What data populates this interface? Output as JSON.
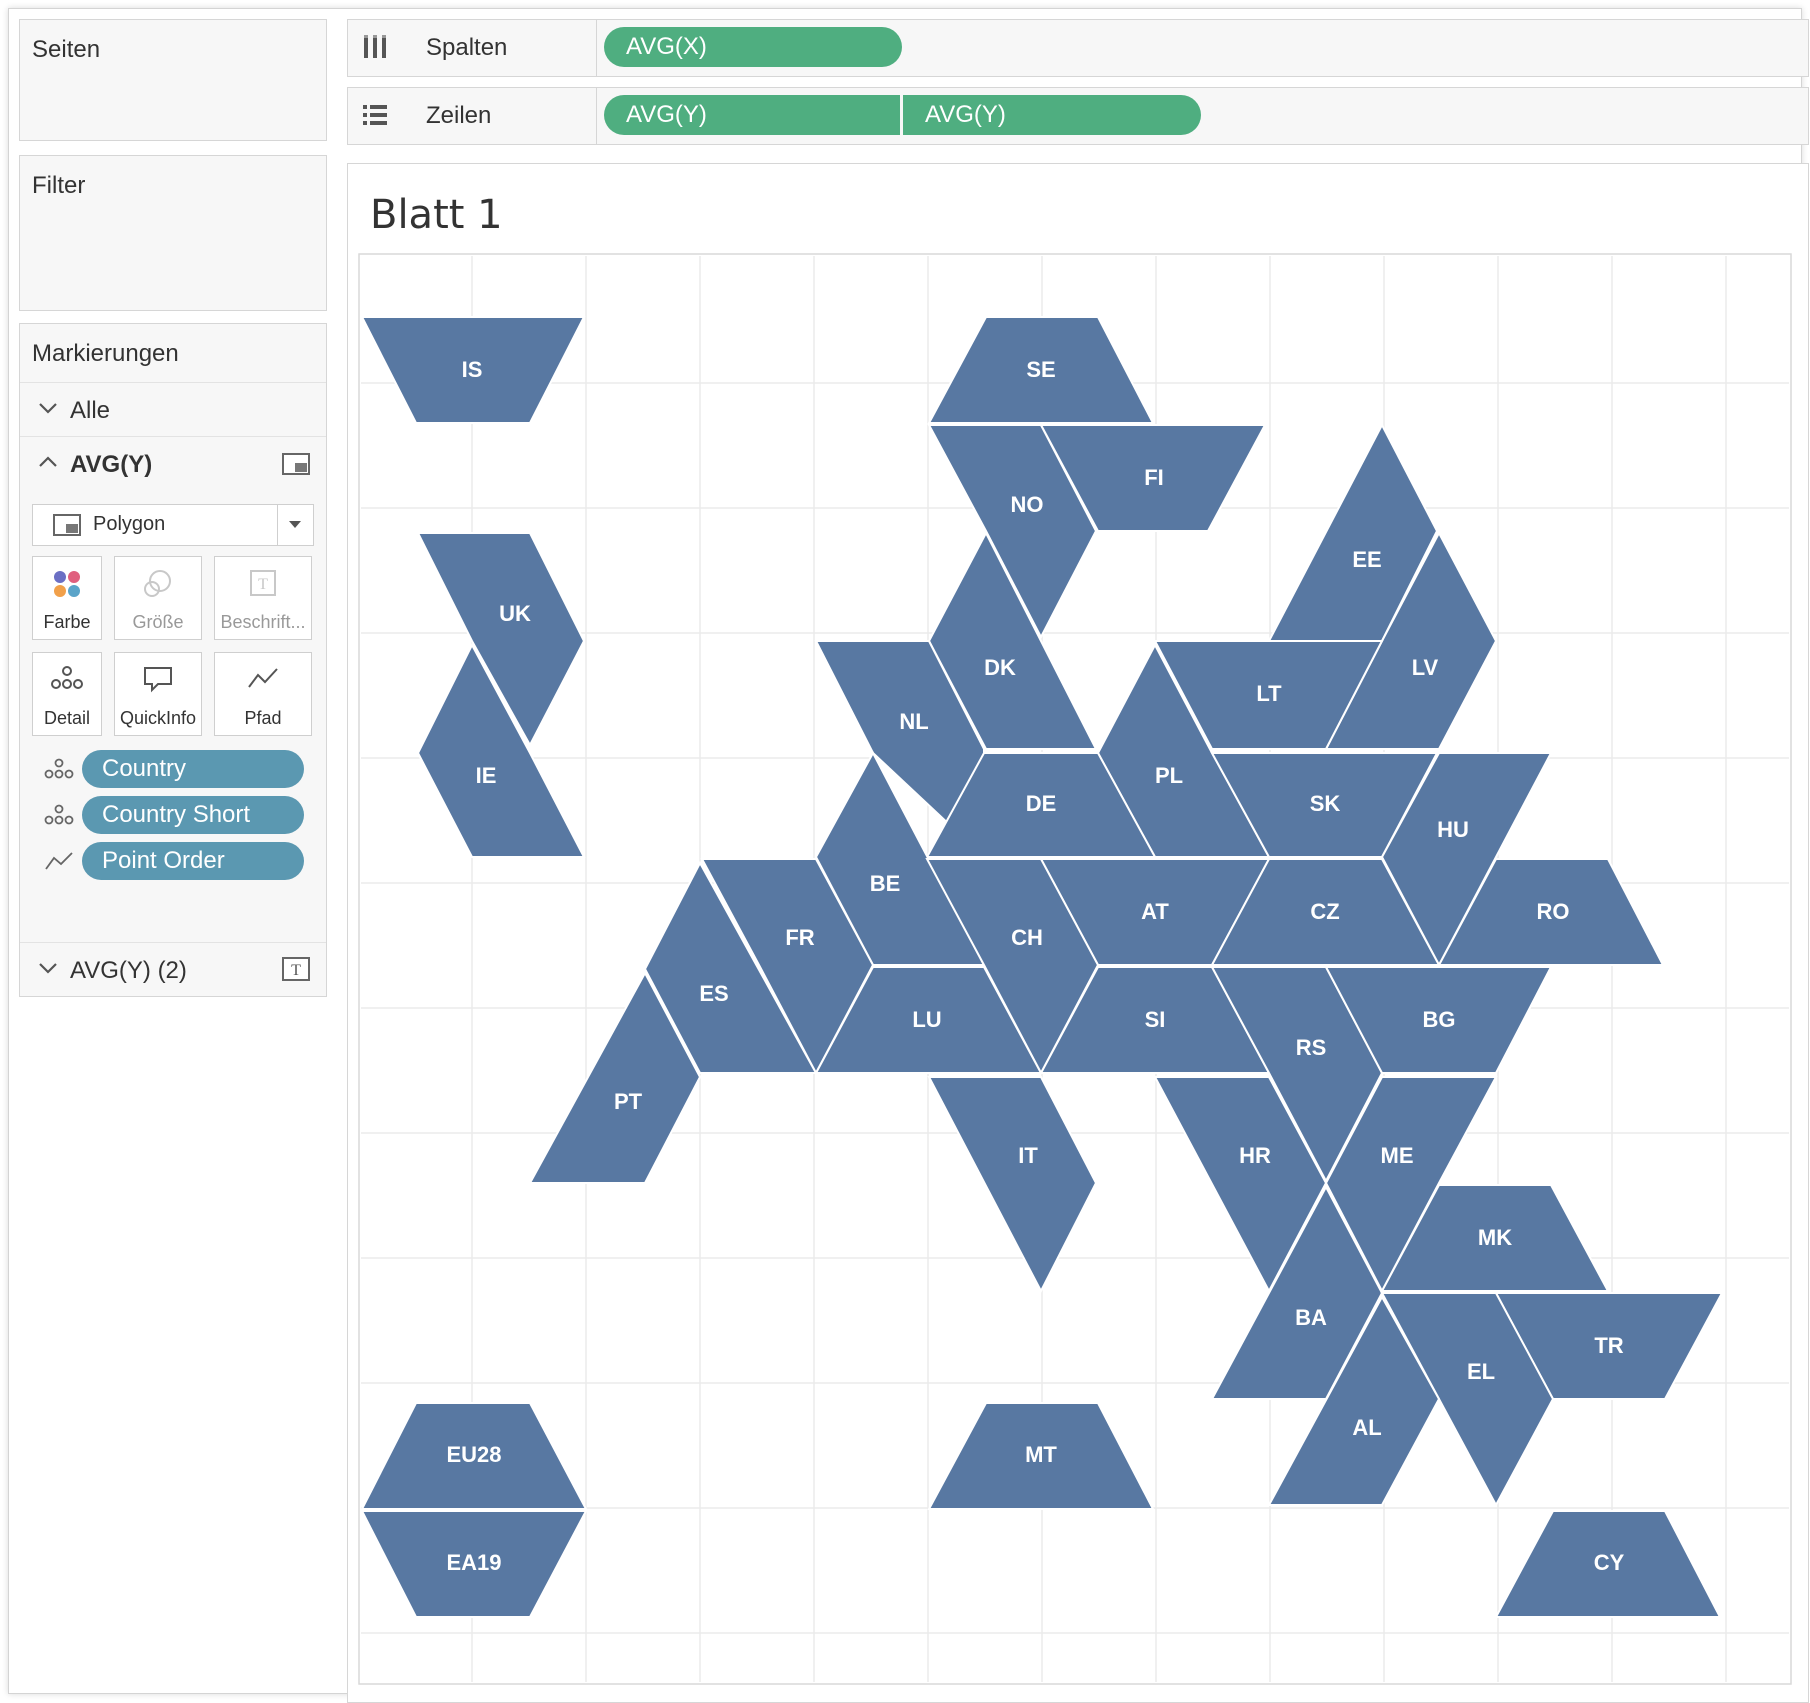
{
  "panels": {
    "pages_label": "Seiten",
    "filter_label": "Filter"
  },
  "marks": {
    "title": "Markierungen",
    "all_label": "Alle",
    "layer1_label": "AVG(Y)",
    "layer2_label": "AVG(Y) (2)",
    "mark_type": "Polygon",
    "buttons": {
      "color": "Farbe",
      "size": "Größe",
      "label": "Beschrift...",
      "detail": "Detail",
      "tooltip": "QuickInfo",
      "path": "Pfad"
    },
    "fields": [
      "Country",
      "Country Short",
      "Point Order"
    ]
  },
  "shelves": {
    "columns_label": "Spalten",
    "rows_label": "Zeilen",
    "columns_pill": "AVG(X)",
    "rows_pills": [
      "AVG(Y)",
      "AVG(Y)"
    ]
  },
  "sheet": {
    "title": "Blatt 1"
  },
  "colors": {
    "tile": "#5878a2",
    "shelf_pill": "#4fae80",
    "field_pill": "#5b98b1"
  },
  "chart_data": {
    "type": "polygon tile map",
    "tiles": [
      "IS",
      "SE",
      "NO",
      "FI",
      "EE",
      "UK",
      "DK",
      "LV",
      "LT",
      "NL",
      "IE",
      "PL",
      "DE",
      "SK",
      "HU",
      "BE",
      "AT",
      "CZ",
      "RO",
      "FR",
      "CH",
      "ES",
      "LU",
      "SI",
      "RS",
      "BG",
      "PT",
      "IT",
      "HR",
      "ME",
      "MK",
      "BA",
      "TR",
      "EL",
      "AL",
      "EU28",
      "MT",
      "EA19",
      "CY"
    ]
  }
}
